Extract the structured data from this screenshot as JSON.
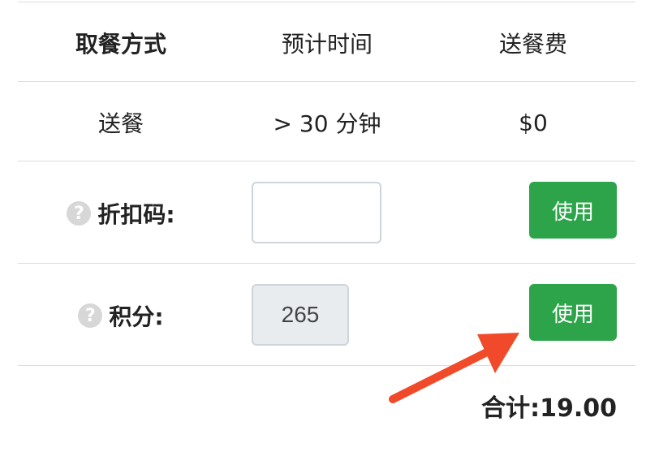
{
  "table": {
    "headers": [
      "取餐方式",
      "预计时间",
      "送餐费"
    ],
    "delivery_row": {
      "method": "送餐",
      "time": "> 30 分钟",
      "fee": "$0"
    }
  },
  "discount": {
    "label": "折扣码:",
    "help_glyph": "?",
    "input_value": "",
    "button_label": "使用"
  },
  "points": {
    "label": "积分:",
    "help_glyph": "?",
    "input_value": "265",
    "button_label": "使用"
  },
  "total": {
    "text": "合计:19.00"
  },
  "colors": {
    "button": "#2ea44a",
    "arrow": "#f04a2a"
  }
}
